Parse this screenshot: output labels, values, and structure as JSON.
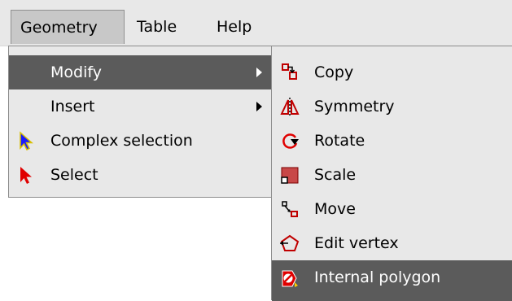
{
  "menubar": {
    "items": [
      {
        "label": "Geometry"
      },
      {
        "label": "Table"
      },
      {
        "label": "Help"
      }
    ]
  },
  "geometry_menu": {
    "items": [
      {
        "label": "Modify",
        "icon": "none",
        "submenu": true,
        "selected": true
      },
      {
        "label": "Insert",
        "icon": "none",
        "submenu": true
      },
      {
        "label": "Complex selection",
        "icon": "blue-pointer-icon"
      },
      {
        "label": "Select",
        "icon": "red-pointer-icon"
      }
    ]
  },
  "modify_menu": {
    "items": [
      {
        "label": "Copy",
        "icon": "copy-icon"
      },
      {
        "label": "Symmetry",
        "icon": "symmetry-icon"
      },
      {
        "label": "Rotate",
        "icon": "rotate-icon"
      },
      {
        "label": "Scale",
        "icon": "scale-icon"
      },
      {
        "label": "Move",
        "icon": "move-icon"
      },
      {
        "label": "Edit vertex",
        "icon": "edit-vertex-icon"
      },
      {
        "label": "Internal polygon",
        "icon": "internal-polygon-icon",
        "selected": true
      }
    ]
  },
  "colors": {
    "menu_bg": "#e8e8e8",
    "selected_bg": "#5b5b5b",
    "selected_text": "#ffffff",
    "accent_red": "#e00000"
  }
}
